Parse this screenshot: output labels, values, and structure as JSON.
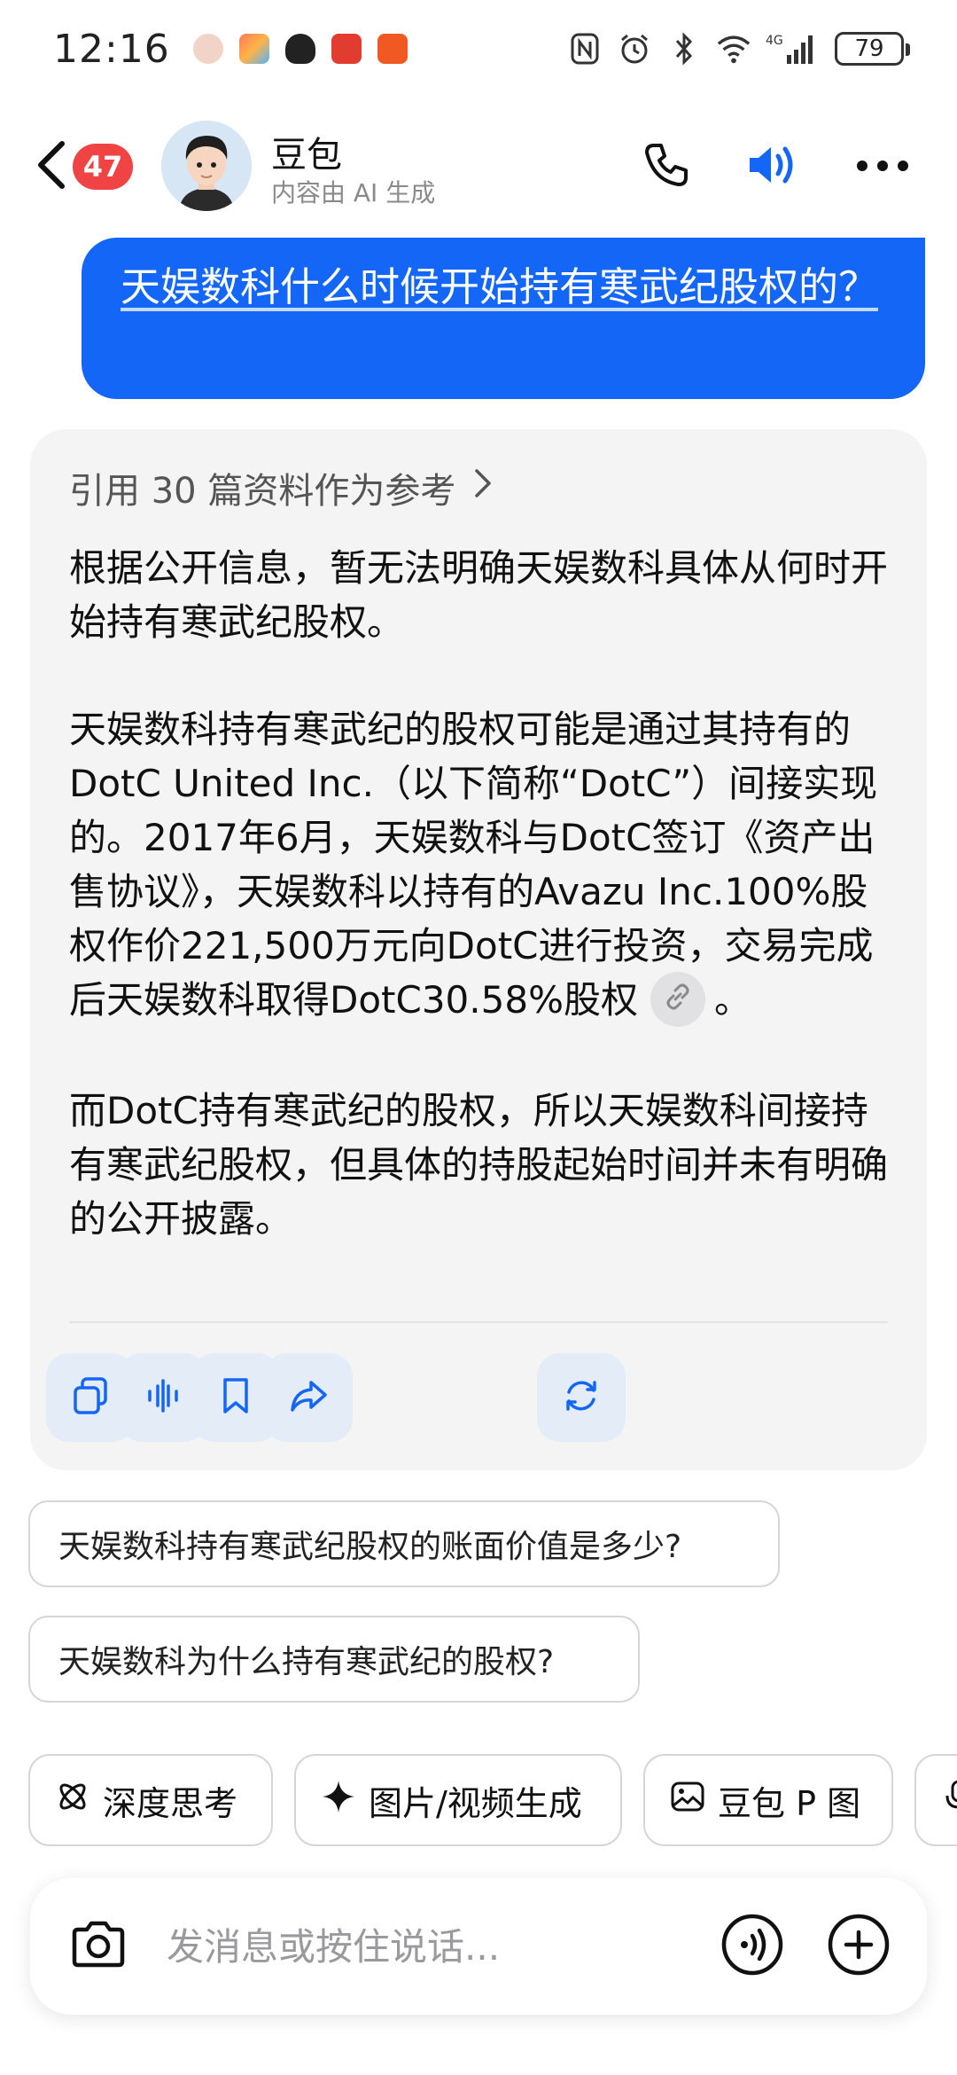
{
  "status_bar": {
    "time": "12:16",
    "network": "4G",
    "battery": "79"
  },
  "header": {
    "badge_count": "47",
    "bot_name": "豆包",
    "bot_subtitle": "内容由 AI 生成"
  },
  "conversation": {
    "user_message": "天娱数科什么时候开始持有寒武纪股权的？",
    "ai_answer": {
      "references_label": "引用 30 篇资料作为参考",
      "paragraph_1": "根据公开信息，暂无法明确天娱数科具体从何时开始持有寒武纪股权。",
      "paragraph_2": "天娱数科持有寒武纪的股权可能是通过其持有的DotC United Inc.（以下简称“DotC”）间接实现的。2017年6月，天娱数科与DotC签订《资产出售协议》，天娱数科以持有的Avazu Inc.100%股权作价221,500万元向DotC进行投资，交易完成后天娱数科取得DotC30.58%股权",
      "paragraph_2_end": "。",
      "paragraph_3": "而DotC持有寒武纪的股权，所以天娱数科间接持有寒武纪股权，但具体的持股起始时间并未有明确的公开披露。"
    }
  },
  "suggestions": [
    "天娱数科持有寒武纪股权的账面价值是多少?",
    "天娱数科为什么持有寒武纪的股权?"
  ],
  "feature_chips": [
    "深度思考",
    "图片/视频生成",
    "豆包 P 图"
  ],
  "input": {
    "placeholder": "发消息或按住说话..."
  },
  "colors": {
    "accent_blue": "#1466f6",
    "badge_red": "#f04343",
    "card_bg": "#f4f4f5",
    "action_btn_bg": "#e4ecf8"
  }
}
